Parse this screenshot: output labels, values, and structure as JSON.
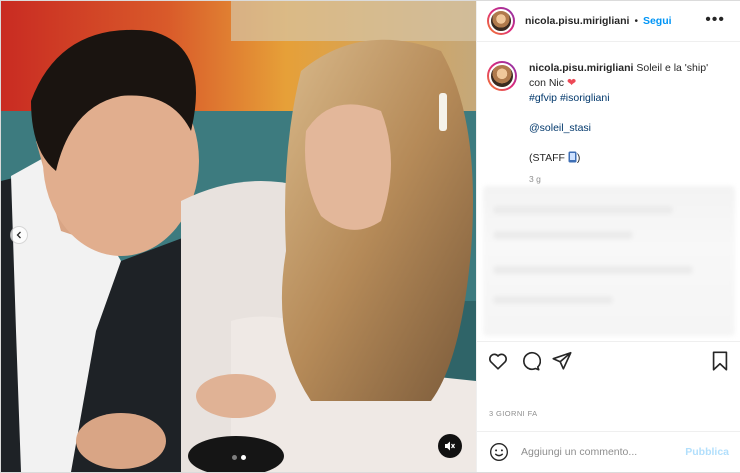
{
  "post": {
    "username": "nicola.pisu.mirigliani",
    "separator": "•",
    "follow_label": "Segui",
    "more_icon": "more-options-icon"
  },
  "caption": {
    "username": "nicola.pisu.mirigliani",
    "text": "Soleil e la 'ship' con Nic",
    "heart_icon": "red-heart-emoji",
    "hashtags": [
      "#gfvip",
      "#isorigliani"
    ],
    "mention": "@soleil_stasi",
    "staff_text": "(STAFF",
    "staff_icon": "mobile-phone-emoji",
    "staff_close": ")",
    "time_ago": "3 g"
  },
  "media": {
    "carousel_dots": 2,
    "active_dot": 1,
    "prev_icon": "chevron-left-icon",
    "mute_icon": "speaker-muted-icon"
  },
  "actions": {
    "like_icon": "heart-outline-icon",
    "comment_icon": "comment-bubble-icon",
    "share_icon": "paper-plane-icon",
    "save_icon": "bookmark-icon"
  },
  "date_label": "3 GIORNI FA",
  "comment": {
    "emoji_icon": "smiley-icon",
    "placeholder": "Aggiungi un commento...",
    "publish_label": "Pubblica"
  },
  "colors": {
    "link_blue": "#0095f6",
    "hashtag_blue": "#00376b",
    "publish_disabled": "#b2dffc",
    "heart_red": "#ed4956",
    "muted_gray": "#8e8e8e"
  }
}
